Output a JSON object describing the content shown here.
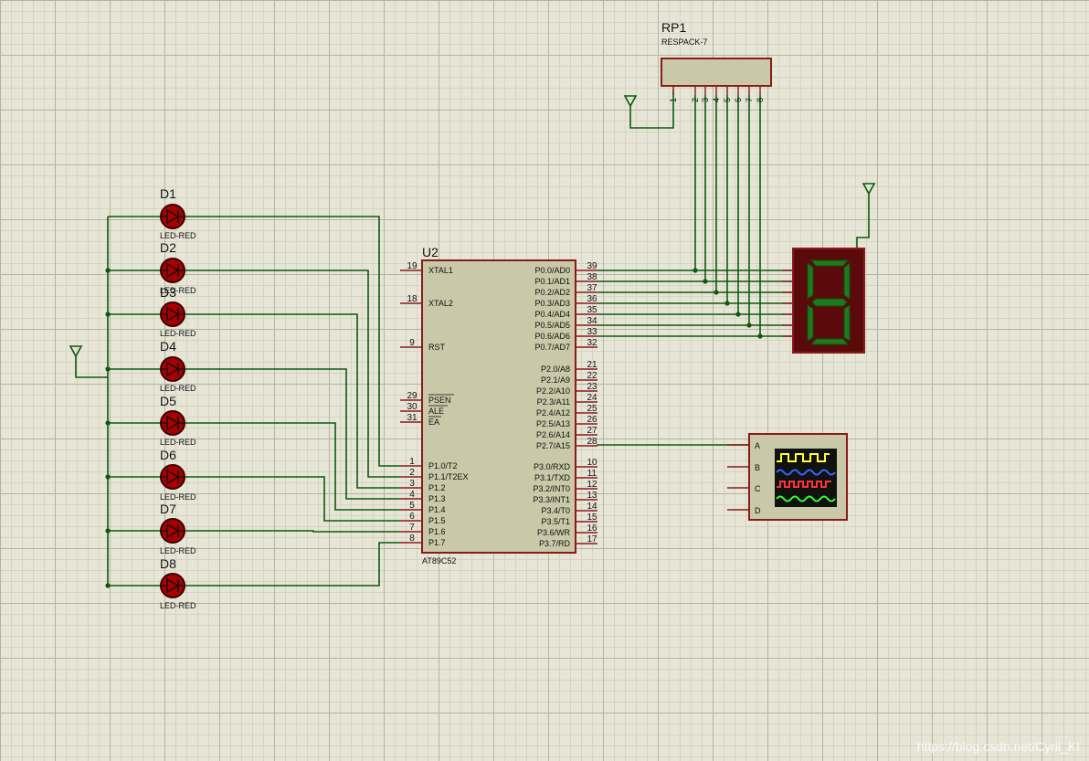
{
  "diagram": {
    "rp1": {
      "ref": "RP1",
      "value": "RESPACK-7",
      "pins": [
        "1",
        "2",
        "3",
        "4",
        "5",
        "6",
        "7",
        "8"
      ]
    },
    "u2": {
      "ref": "U2",
      "value": "AT89C52",
      "left_pins": [
        {
          "num": "19",
          "name": "XTAL1"
        },
        {
          "num": "18",
          "name": "XTAL2"
        },
        {
          "num": "9",
          "name": "RST"
        },
        {
          "num": "29",
          "name": "PSEN"
        },
        {
          "num": "30",
          "name": "ALE"
        },
        {
          "num": "31",
          "name": "EA"
        },
        {
          "num": "1",
          "name": "P1.0/T2"
        },
        {
          "num": "2",
          "name": "P1.1/T2EX"
        },
        {
          "num": "3",
          "name": "P1.2"
        },
        {
          "num": "4",
          "name": "P1.3"
        },
        {
          "num": "5",
          "name": "P1.4"
        },
        {
          "num": "6",
          "name": "P1.5"
        },
        {
          "num": "7",
          "name": "P1.6"
        },
        {
          "num": "8",
          "name": "P1.7"
        }
      ],
      "right_pins": [
        {
          "num": "39",
          "name": "P0.0/AD0"
        },
        {
          "num": "38",
          "name": "P0.1/AD1"
        },
        {
          "num": "37",
          "name": "P0.2/AD2"
        },
        {
          "num": "36",
          "name": "P0.3/AD3"
        },
        {
          "num": "35",
          "name": "P0.4/AD4"
        },
        {
          "num": "34",
          "name": "P0.5/AD5"
        },
        {
          "num": "33",
          "name": "P0.6/AD6"
        },
        {
          "num": "32",
          "name": "P0.7/AD7"
        },
        {
          "num": "21",
          "name": "P2.0/A8"
        },
        {
          "num": "22",
          "name": "P2.1/A9"
        },
        {
          "num": "23",
          "name": "P2.2/A10"
        },
        {
          "num": "24",
          "name": "P2.3/A11"
        },
        {
          "num": "25",
          "name": "P2.4/A12"
        },
        {
          "num": "26",
          "name": "P2.5/A13"
        },
        {
          "num": "27",
          "name": "P2.6/A14"
        },
        {
          "num": "28",
          "name": "P2.7/A15"
        },
        {
          "num": "10",
          "name": "P3.0/RXD"
        },
        {
          "num": "11",
          "name": "P3.1/TXD"
        },
        {
          "num": "12",
          "name": "P3.2/INT0"
        },
        {
          "num": "13",
          "name": "P3.3/INT1"
        },
        {
          "num": "14",
          "name": "P3.4/T0"
        },
        {
          "num": "15",
          "name": "P3.5/T1"
        },
        {
          "num": "16",
          "name": "P3.6/WR"
        },
        {
          "num": "17",
          "name": "P3.7/RD"
        }
      ]
    },
    "leds": [
      {
        "ref": "D1",
        "value": "LED-RED"
      },
      {
        "ref": "D2",
        "value": "LED-RED"
      },
      {
        "ref": "D3",
        "value": "LED-RED"
      },
      {
        "ref": "D4",
        "value": "LED-RED"
      },
      {
        "ref": "D5",
        "value": "LED-RED"
      },
      {
        "ref": "D6",
        "value": "LED-RED"
      },
      {
        "ref": "D7",
        "value": "LED-RED"
      },
      {
        "ref": "D8",
        "value": "LED-RED"
      }
    ],
    "scope_channels": [
      "A",
      "B",
      "C",
      "D"
    ],
    "colors": {
      "wire": "#0b5a0b",
      "component_fill": "#c9c8a8",
      "component_border": "#8b1a1a",
      "led_fill": "#a80000",
      "segment_on": "#1f7a1f",
      "display_body": "#5a0a0a"
    }
  },
  "watermark": "https://blog.csdn.net/Cyril_KI"
}
